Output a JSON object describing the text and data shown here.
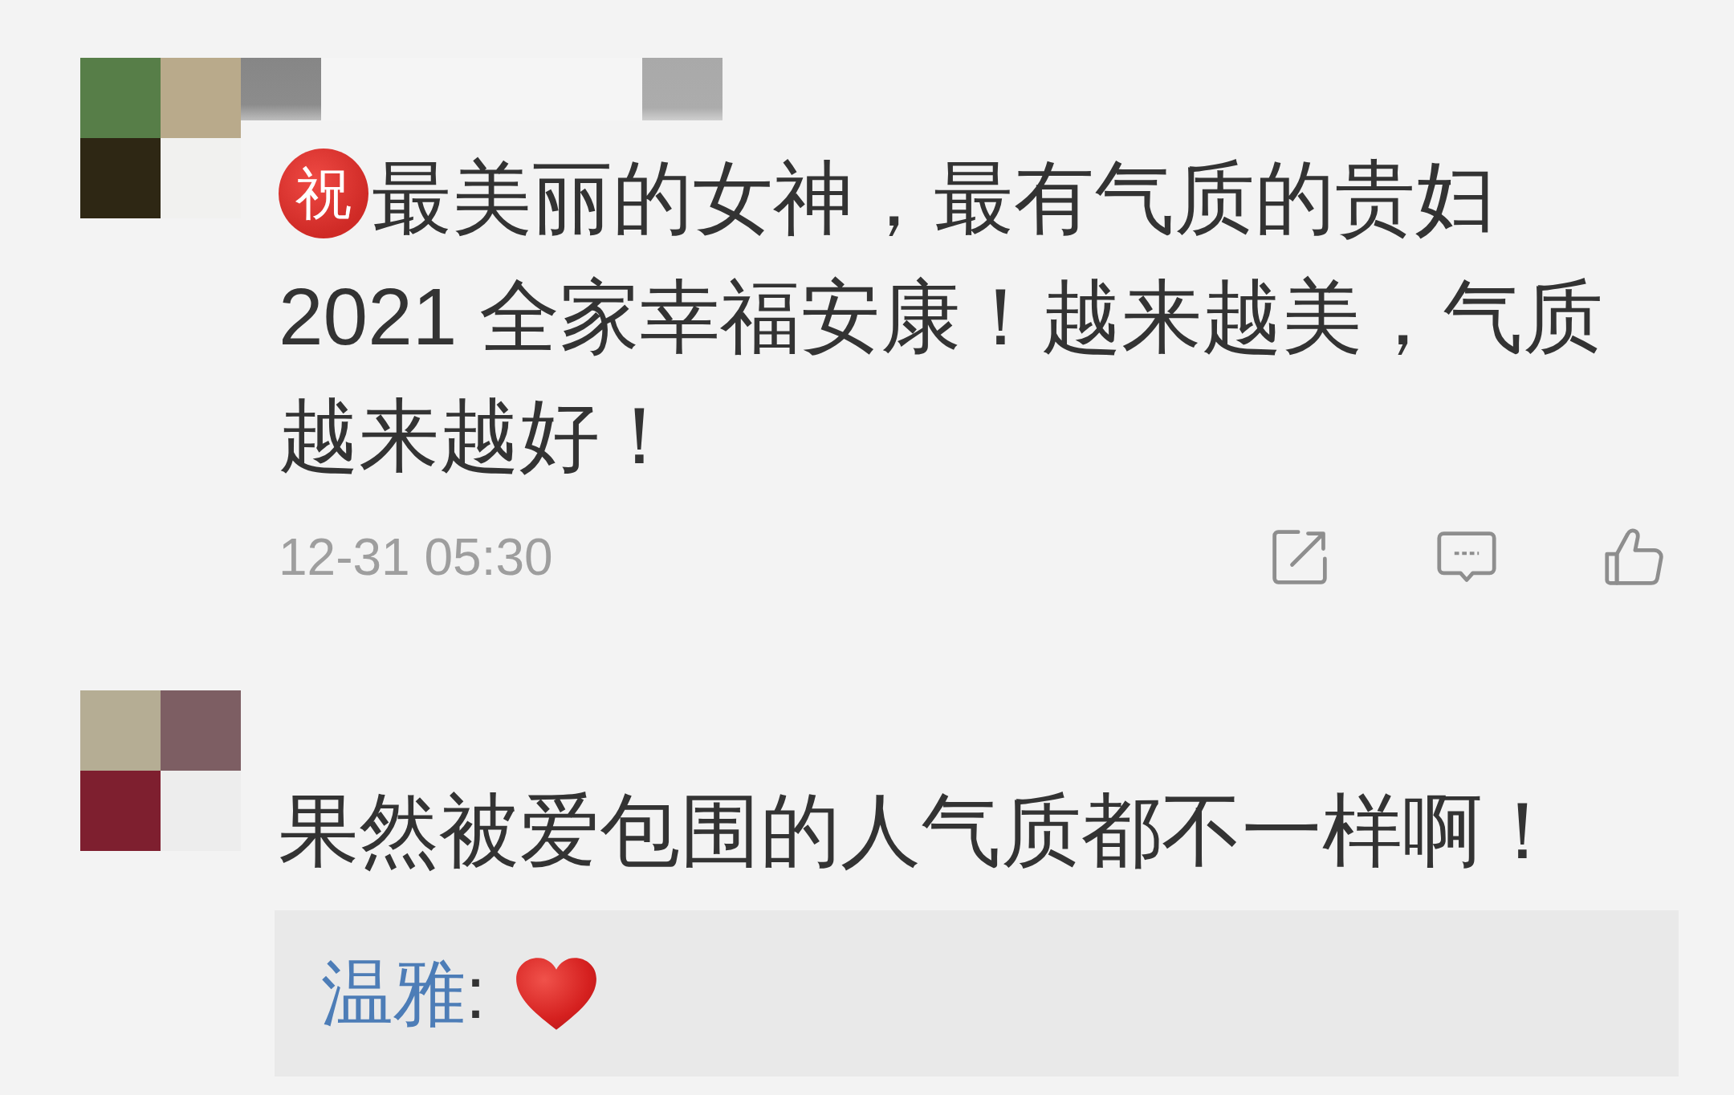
{
  "comments": [
    {
      "emoticon": "祝",
      "text": "最美丽的女神，最有气质的贵妇2021 全家幸福安康！越来越美，气质越来越好！",
      "time": "12-31 05:30"
    },
    {
      "text": "果然被爱包围的人气质都不一样啊！",
      "replies": [
        {
          "author": "温雅",
          "separator": ":"
        }
      ]
    }
  ]
}
